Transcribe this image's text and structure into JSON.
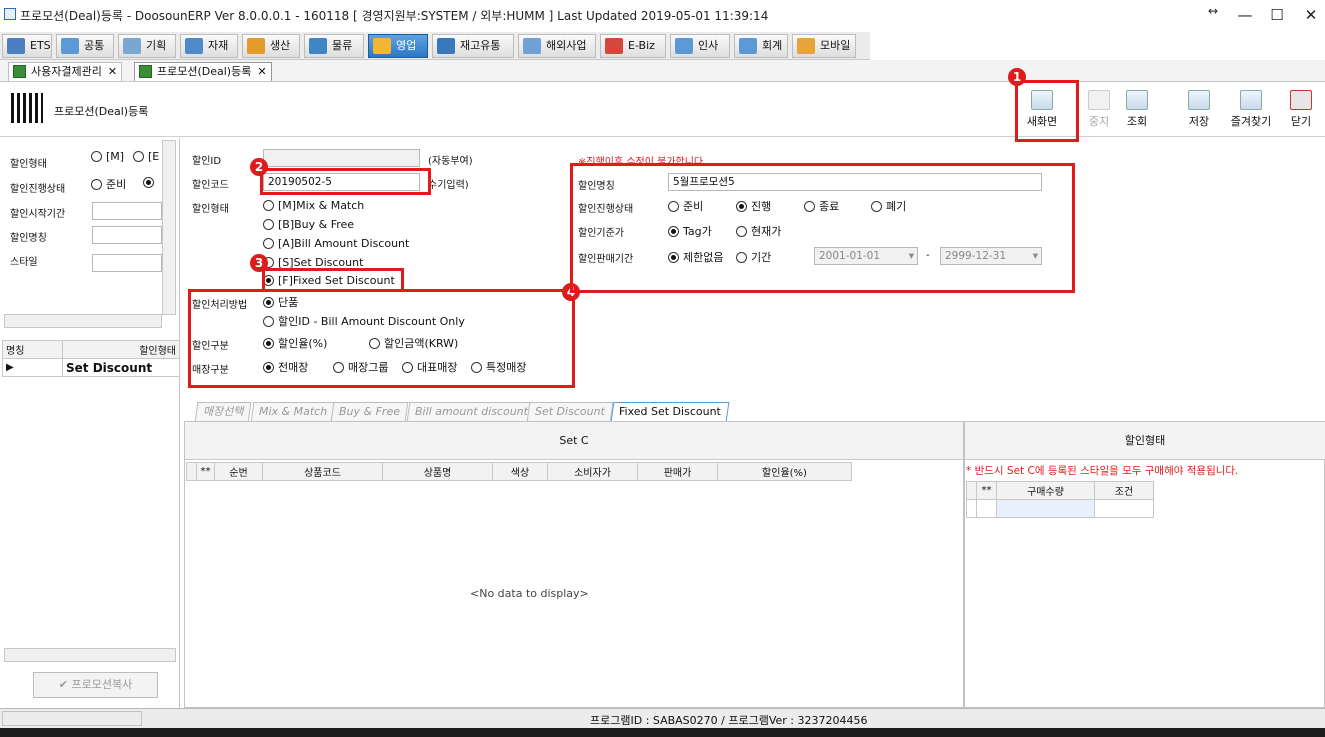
{
  "window": {
    "title": "프로모션(Deal)등록 - DoosounERP Ver 8.0.0.0.1 - 160118 [ 경영지원부:SYSTEM / 외부:HUMM ]    Last Updated 2019-05-01 11:39:14",
    "controls": {
      "restore": "↔",
      "minimize": "—",
      "maximize": "☐",
      "close": "✕"
    }
  },
  "menu": [
    "ETS",
    "공통",
    "기획",
    "자재",
    "생산",
    "물류",
    "영업",
    "재고유통",
    "해외사업",
    "E-Biz",
    "인사",
    "회계",
    "모바일"
  ],
  "menu_active": "영업",
  "doc_tabs": [
    {
      "label": "사용자결제관리",
      "close": "✕"
    },
    {
      "label": "프로모션(Deal)등록",
      "close": "✕"
    }
  ],
  "header": {
    "title": "프로모션(Deal)등록"
  },
  "toolbar": {
    "new": "새화면",
    "stop": "중지",
    "search": "조회",
    "save": "저장",
    "favorite": "즐겨찾기",
    "close": "닫기"
  },
  "left": {
    "labels": [
      "할인형태",
      "할인진행상태",
      "할인시작기간",
      "할인명칭",
      "스타일"
    ],
    "type_opts": [
      "[M]",
      "[E"
    ],
    "status_opt": "준비",
    "copy_button": "프로모션복사",
    "grid": {
      "headers": [
        "명칭",
        "할인형태"
      ],
      "rows": [
        {
          "marker": "▶",
          "name": "",
          "type": "Set Discount"
        }
      ]
    }
  },
  "form": {
    "id_label": "할인ID",
    "id_value": "",
    "id_note": "(자동부여)",
    "code_label": "할인코드",
    "code_value": "20190502-5",
    "code_note": "수기입력)",
    "type_label": "할인형태",
    "types": [
      "[M]Mix & Match",
      "[B]Buy & Free",
      "[A]Bill Amount Discount",
      "[S]Set Discount",
      "[F]Fixed Set Discount"
    ],
    "type_selected": 4,
    "warning": "※진행이후 수정이 불가합니다.",
    "name_label": "할인명칭",
    "name_value": "5월프로모션5",
    "status_label": "할인진행상태",
    "status_opts": [
      "준비",
      "진행",
      "종료",
      "폐기"
    ],
    "status_selected": 1,
    "price_label": "할인기준가",
    "price_opts": [
      "Tag가",
      "현재가"
    ],
    "price_selected": 0,
    "period_label": "할인판매기간",
    "period_opts": [
      "제한없음",
      "기간"
    ],
    "period_selected": 0,
    "date_from": "2001-01-01",
    "date_sep": "-",
    "date_to": "2999-12-31",
    "method_label": "할인처리방법",
    "method_opts": [
      "단품",
      "할인ID - Bill Amount Discount Only"
    ],
    "method_selected": 0,
    "kind_label": "할인구분",
    "kind_opts": [
      "할인율(%)",
      "할인금액(KRW)"
    ],
    "kind_selected": 0,
    "store_label": "매장구분",
    "store_opts": [
      "전매장",
      "매장그룹",
      "대표매장",
      "특정매장"
    ],
    "store_selected": 0
  },
  "annotations": [
    "1",
    "2",
    "3",
    "4"
  ],
  "sub_tabs": [
    "매장선택",
    "Mix & Match",
    "Buy & Free",
    "Bill amount discount",
    "Set Discount",
    "Fixed Set Discount"
  ],
  "sub_tab_active": 5,
  "setc": {
    "title": "Set C",
    "headers": [
      "**",
      "순번",
      "상품코드",
      "상품명",
      "색상",
      "소비자가",
      "판매가",
      "할인율(%)"
    ],
    "empty": "<No data to display>"
  },
  "discount_state": {
    "title": "할인형태",
    "notice": "* 반드시 Set C에 등록된 스타일을 모두 구매해야 적용됩니다.",
    "headers": [
      "**",
      "구매수량",
      "조건"
    ]
  },
  "status": {
    "program": "프로그램ID : SABAS0270 / 프로그램Ver : 3237204456"
  }
}
